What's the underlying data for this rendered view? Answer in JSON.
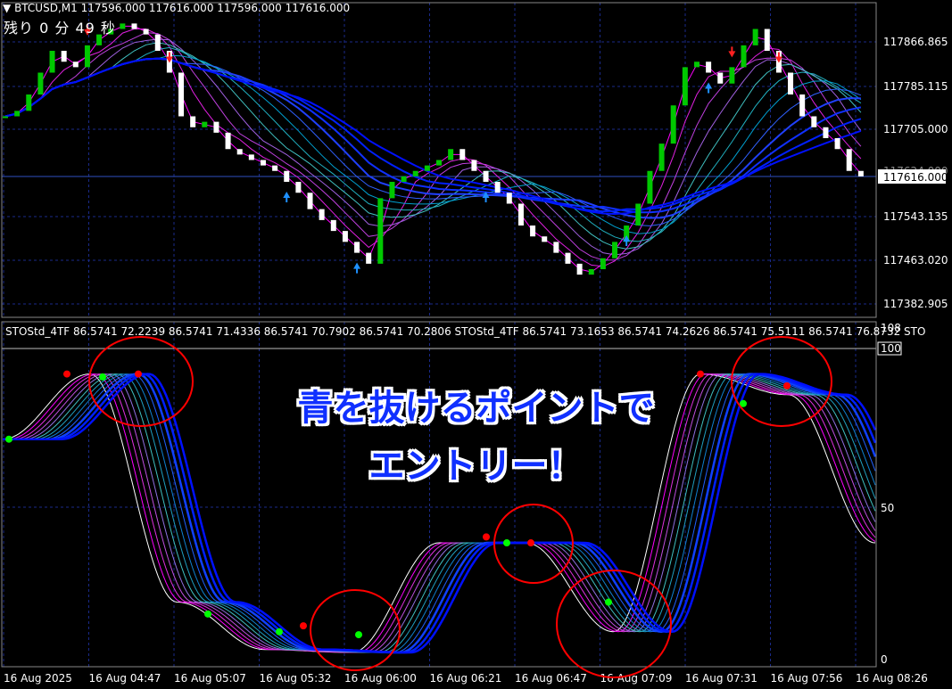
{
  "header": {
    "symbol_title": "BTCUSD,M1",
    "ohlc": "117596.000 117616.000 117596.000 117616.000",
    "countdown": "残り 0 分 49 秒"
  },
  "price_axis": {
    "labels": [
      "117866.865",
      "117785.115",
      "117705.000",
      "117543.135",
      "117463.020",
      "117382.905"
    ],
    "current_price": "117616.000",
    "hidden_label_fragment": "117624.000"
  },
  "indicator": {
    "header": "STOStd_4TF 86.5741 72.2239 86.5741 71.4336 86.5741 70.7902 86.5741 70.2806  STOStd_4TF 86.5741 73.1653 86.5741 74.2626 86.5741 75.5111 86.5741 76.8732  STO",
    "axis_labels": [
      "108",
      "100",
      "50",
      "0"
    ]
  },
  "time_axis": {
    "labels": [
      "16 Aug 2025",
      "16 Aug 04:47",
      "16 Aug 05:07",
      "16 Aug 05:32",
      "16 Aug 06:00",
      "16 Aug 06:21",
      "16 Aug 06:47",
      "16 Aug 07:09",
      "16 Aug 07:31",
      "16 Aug 07:56",
      "16 Aug 08:26"
    ]
  },
  "annotation": {
    "line1": "青を抜けるポイントで",
    "line2": "エントリー！"
  },
  "colors": {
    "background": "#000000",
    "bull_candle": "#00c800",
    "bear_candle": "#ffffff",
    "grid": "#1a2a8a",
    "axis_text": "#ffffff",
    "ribbon_slow": "#0000ff",
    "ribbon_mid": "#00c8c8",
    "ribbon_fast": "#ff00ff",
    "circle": "#ff0000",
    "dot_buy": "#00ff00",
    "dot_sell": "#ff0000",
    "arrow_buy": "#1e90ff",
    "arrow_sell": "#ff2020"
  },
  "chart_data": [
    {
      "type": "candlestick",
      "title": "BTCUSD,M1",
      "ylim": [
        117340,
        117900
      ],
      "close_series": [
        117700,
        117710,
        117740,
        117780,
        117820,
        117800,
        117790,
        117830,
        117850,
        117860,
        117870,
        117860,
        117850,
        117820,
        117780,
        117700,
        117680,
        117690,
        117670,
        117640,
        117630,
        117620,
        117610,
        117600,
        117580,
        117560,
        117530,
        117510,
        117490,
        117470,
        117450,
        117430,
        117550,
        117580,
        117590,
        117600,
        117610,
        117620,
        117640,
        117620,
        117600,
        117580,
        117560,
        117540,
        117500,
        117480,
        117470,
        117450,
        117430,
        117410,
        117420,
        117440,
        117470,
        117500,
        117540,
        117600,
        117650,
        117720,
        117790,
        117800,
        117780,
        117760,
        117790,
        117830,
        117860,
        117820,
        117780,
        117740,
        117700,
        117680,
        117660,
        117640,
        117600,
        117590
      ],
      "note": "M1 candles estimated from price axis"
    },
    {
      "type": "line",
      "title": "STOStd_4TF",
      "ylim": [
        0,
        108
      ],
      "x": [
        "16 Aug 2025",
        "16 Aug 04:47",
        "16 Aug 05:07",
        "16 Aug 05:32",
        "16 Aug 06:00",
        "16 Aug 06:21",
        "16 Aug 06:47",
        "16 Aug 07:09",
        "16 Aug 07:31",
        "16 Aug 07:56",
        "16 Aug 08:26"
      ],
      "series": [
        {
          "name": "STOStd_4TF",
          "values": [
            75,
            97,
            20,
            4,
            3,
            40,
            40,
            10,
            97,
            90,
            40
          ]
        }
      ]
    }
  ]
}
